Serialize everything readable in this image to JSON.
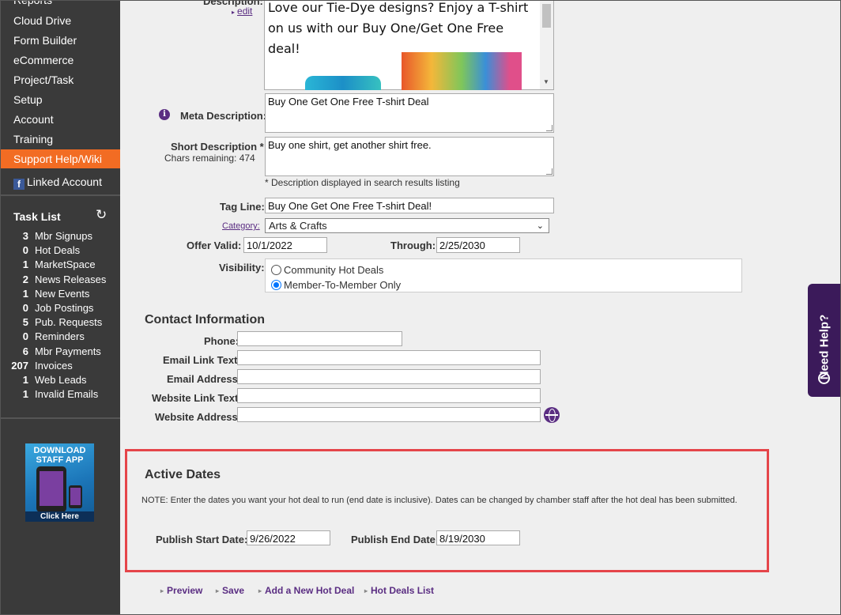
{
  "sidebar": {
    "nav": [
      "Reports",
      "Cloud Drive",
      "Form Builder",
      "eCommerce",
      "Project/Task",
      "Setup",
      "Account",
      "Training",
      "Support Help/Wiki",
      "Linked Account"
    ],
    "task_list_title": "Task List",
    "tasks": [
      {
        "count": "3",
        "label": "Mbr Signups"
      },
      {
        "count": "0",
        "label": "Hot Deals"
      },
      {
        "count": "1",
        "label": "MarketSpace"
      },
      {
        "count": "2",
        "label": "News Releases"
      },
      {
        "count": "1",
        "label": "New Events"
      },
      {
        "count": "0",
        "label": "Job Postings"
      },
      {
        "count": "5",
        "label": "Pub. Requests"
      },
      {
        "count": "0",
        "label": "Reminders"
      },
      {
        "count": "6",
        "label": "Mbr Payments"
      },
      {
        "count": "207",
        "label": "Invoices"
      },
      {
        "count": "1",
        "label": "Web Leads"
      },
      {
        "count": "1",
        "label": "Invalid Emails"
      }
    ],
    "promo": {
      "line1": "DOWNLOAD",
      "line2": "STAFF APP",
      "click": "Click Here"
    }
  },
  "form": {
    "description_label": "Description:",
    "edit_link": "edit",
    "description_text": "Love our Tie-Dye designs? Enjoy a T-shirt on us with our Buy One/Get One Free deal!",
    "meta_label": "Meta Description:",
    "meta_value": "Buy One Get One Free T-shirt Deal",
    "short_label": "Short Description *:",
    "chars_remaining": "Chars remaining: 474",
    "short_value": "Buy one shirt, get another shirt free.",
    "short_hint": "* Description displayed in search results listing",
    "tagline_label": "Tag Line:",
    "tagline_value": "Buy One Get One Free T-shirt Deal!",
    "category_label": "Category:",
    "category_value": "Arts & Crafts",
    "offer_valid_label": "Offer Valid:",
    "offer_valid_value": "10/1/2022",
    "through_label": "Through:",
    "through_value": "2/25/2030",
    "visibility_label": "Visibility:",
    "visibility_options": [
      "Community Hot Deals",
      "Member-To-Member Only"
    ],
    "visibility_selected": "Member-To-Member Only"
  },
  "contact": {
    "title": "Contact Information",
    "phone_label": "Phone:",
    "phone_value": "",
    "email_link_label": "Email Link Text:",
    "email_address_label": "Email Address:",
    "website_link_label": "Website Link Text:",
    "website_address_label": "Website Address:"
  },
  "active_dates": {
    "title": "Active Dates",
    "note": "NOTE: Enter the dates you want your hot deal to run (end date is inclusive). Dates can be changed by chamber staff after the hot deal has been submitted.",
    "start_label": "Publish Start Date:",
    "start_value": "9/26/2022",
    "end_label": "Publish End Date:",
    "end_value": "8/19/2030"
  },
  "actions": [
    "Preview",
    "Save",
    "Add a New Hot Deal",
    "Hot Deals List"
  ],
  "help_tab": "Need Help?",
  "colors": {
    "sidebar": "#3a3a3a",
    "active_nav": "#f26c23",
    "accent": "#5a2d82",
    "highlight_box": "#e5454a"
  }
}
